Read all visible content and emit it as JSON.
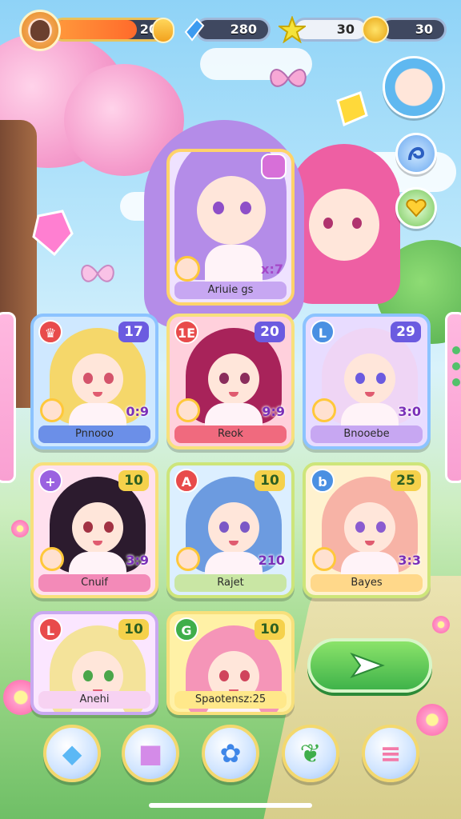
{
  "hud": {
    "energy": {
      "value": "20",
      "fill_fraction": 0.72
    },
    "gems": {
      "value": "280"
    },
    "stars": {
      "value": "30"
    },
    "coins": {
      "value": "30"
    }
  },
  "featured": {
    "name": "Ariuie gs",
    "level": "x:7"
  },
  "cards": [
    {
      "rank": "",
      "number": "17",
      "level": "0:9",
      "name": "Pnnooo",
      "hair": "#f5d76a",
      "eye": "#d4546b",
      "bg": "#cfe8ff",
      "name_bg": "#6b8fe8",
      "border": "#8cc3ff",
      "num_style": "purple",
      "rank_style": ""
    },
    {
      "rank": "1E",
      "number": "20",
      "level": "9:9",
      "name": "Reok",
      "hair": "#a8235a",
      "eye": "#8a2d5c",
      "bg": "#ffd0dc",
      "name_bg": "#f06a7e",
      "border": "#f7e07c",
      "num_style": "purple",
      "rank_style": ""
    },
    {
      "rank": "L",
      "number": "29",
      "level": "3:0",
      "name": "Bnooebe",
      "hair": "#efd5f5",
      "eye": "#6b5be0",
      "bg": "#e8dcff",
      "name_bg": "#c7a7f2",
      "border": "#8cc3ff",
      "num_style": "purple",
      "rank_style": "blue"
    },
    {
      "rank": "+",
      "number": "10",
      "level": "3:9",
      "name": "Cnuif",
      "hair": "#2c1b2e",
      "eye": "#a23243",
      "bg": "#ffe0ee",
      "name_bg": "#f38ab8",
      "border": "#f7e07c",
      "num_style": "gold",
      "rank_style": "purple"
    },
    {
      "rank": "A",
      "number": "10",
      "level": "210",
      "name": "Rajet",
      "hair": "#6c9be0",
      "eye": "#7b58c6",
      "bg": "#dcefff",
      "name_bg": "#c9e6a4",
      "border": "#cde57a",
      "num_style": "gold",
      "rank_style": ""
    },
    {
      "rank": "b",
      "number": "25",
      "level": "3:3",
      "name": "Bayes",
      "hair": "#f7b3a6",
      "eye": "#8a5bd0",
      "bg": "#fff2cf",
      "name_bg": "#ffd88a",
      "border": "#cde57a",
      "num_style": "gold",
      "rank_style": "blue"
    },
    {
      "rank": "L",
      "number": "10",
      "level": "",
      "name": "Anehi",
      "hair": "#f4e39a",
      "eye": "#4aa64a",
      "bg": "#fbe6ff",
      "name_bg": "#f7d2f2",
      "border": "#c8a8f0",
      "num_style": "gold",
      "rank_style": ""
    },
    {
      "rank": "G",
      "number": "10",
      "level": "",
      "name": "Spaotensz:25",
      "hair": "#f595b8",
      "eye": "#d0445c",
      "bg": "#fff1a6",
      "name_bg": "#ffe88a",
      "border": "#f7e07c",
      "num_style": "gold",
      "rank_style": "green"
    }
  ],
  "nav": [
    {
      "icon": "candy-icon",
      "color": "#5bb8f5"
    },
    {
      "icon": "gift-box-icon",
      "color": "#d48be8"
    },
    {
      "icon": "settings-flower-icon",
      "color": "#3e86e8"
    },
    {
      "icon": "leaf-brush-icon",
      "color": "#3fae4a"
    },
    {
      "icon": "menu-icon",
      "color": "#f37aa8"
    }
  ],
  "side_buttons": [
    {
      "icon": "profile-girl-icon"
    },
    {
      "icon": "magic-swirl-icon"
    },
    {
      "icon": "heart-gem-icon"
    }
  ]
}
